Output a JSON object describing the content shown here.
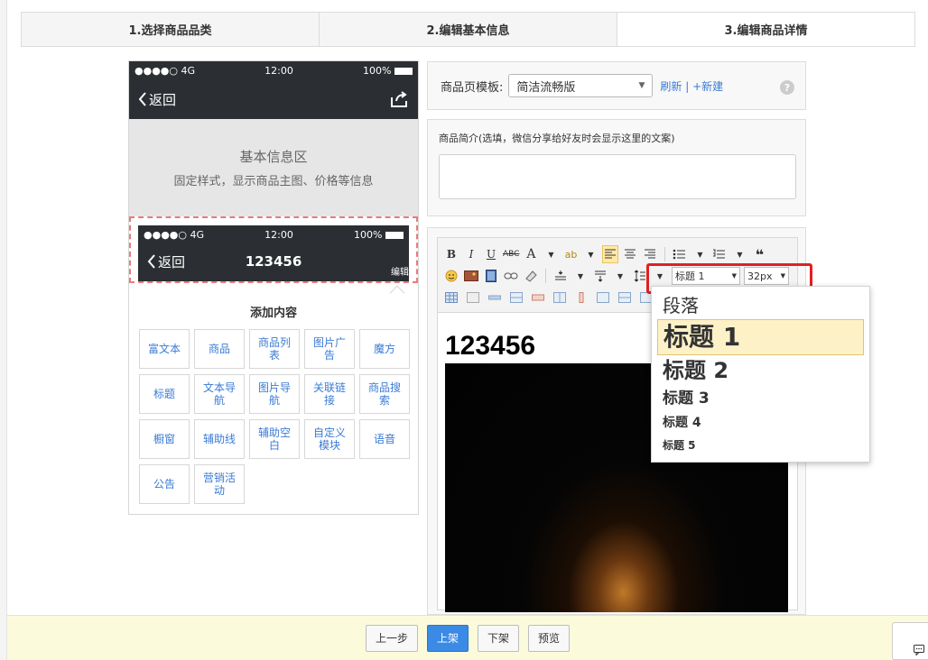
{
  "steps": [
    "1.选择商品品类",
    "2.编辑基本信息",
    "3.编辑商品详情"
  ],
  "phone": {
    "signal": "●●●●○ 4G",
    "time": "12:00",
    "battery": "100%",
    "back": "返回",
    "basic_title": "基本信息区",
    "basic_sub": "固定样式，显示商品主图、价格等信息",
    "title_block": {
      "signal": "●●●●○ 4G",
      "time": "12:00",
      "battery": "100%",
      "back": "返回",
      "title": "123456",
      "edit": "编辑"
    },
    "add_content_title": "添加内容",
    "add_items": [
      "富文本",
      "商品",
      "商品列表",
      "图片广告",
      "魔方",
      "标题",
      "文本导航",
      "图片导航",
      "关联链接",
      "商品搜索",
      "橱窗",
      "辅助线",
      "辅助空白",
      "自定义模块",
      "语音",
      "公告",
      "营销活动"
    ]
  },
  "template": {
    "label": "商品页模板:",
    "value": "简洁流畅版",
    "refresh": "刷新",
    "sep": "|",
    "new": "+新建",
    "help": "?"
  },
  "intro": {
    "label": "商品简介(选填，微信分享给好友时会显示这里的文案)"
  },
  "editor": {
    "bold": "B",
    "italic": "I",
    "underline": "U",
    "strike": "ABC",
    "fontcolor": "A",
    "heading_select": "标题 1",
    "size_select": "32px",
    "content_title": "123456"
  },
  "heading_menu": [
    "段落",
    "标题 1",
    "标题 2",
    "标题 3",
    "标题 4",
    "标题 5"
  ],
  "footer": {
    "prev": "上一步",
    "publish": "上架",
    "unpublish": "下架",
    "preview": "预览"
  }
}
